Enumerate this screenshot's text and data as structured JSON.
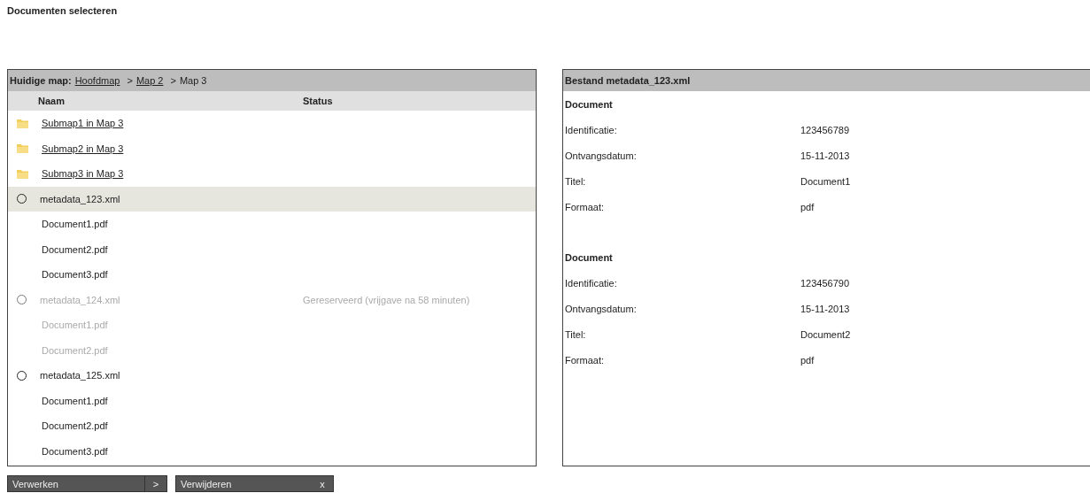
{
  "page_title": "Documenten selecteren",
  "browser": {
    "breadcrumb_label": "Huidige map:",
    "separator": ">",
    "breadcrumb": [
      {
        "label": "Hoofdmap",
        "link": true
      },
      {
        "label": "Map 2",
        "link": true
      },
      {
        "label": "Map 3",
        "link": false
      }
    ],
    "columns": [
      "Naam",
      "Status"
    ],
    "rows": [
      {
        "kind": "folder",
        "name": "Submap1 in Map 3",
        "selected": false
      },
      {
        "kind": "folder",
        "name": "Submap2 in Map 3",
        "selected": false
      },
      {
        "kind": "folder",
        "name": "Submap3 in Map 3",
        "selected": false
      },
      {
        "kind": "xml",
        "name": "metadata_123.xml",
        "selected": true,
        "disabled": false,
        "checked": false
      },
      {
        "kind": "document",
        "name": "Document1.pdf",
        "selected": false,
        "disabled": false
      },
      {
        "kind": "document",
        "name": "Document2.pdf",
        "selected": false,
        "disabled": false
      },
      {
        "kind": "document",
        "name": "Document3.pdf",
        "selected": false,
        "disabled": false
      },
      {
        "kind": "xml",
        "name": "metadata_124.xml",
        "selected": false,
        "disabled": true,
        "checked": false,
        "status": "Gereserveerd (vrijgave na 58 minuten)"
      },
      {
        "kind": "document",
        "name": "Document1.pdf",
        "selected": false,
        "disabled": true
      },
      {
        "kind": "document",
        "name": "Document2.pdf",
        "selected": false,
        "disabled": true
      },
      {
        "kind": "xml",
        "name": "metadata_125.xml",
        "selected": false,
        "disabled": false,
        "checked": false
      },
      {
        "kind": "document",
        "name": "Document1.pdf",
        "selected": false,
        "disabled": false
      },
      {
        "kind": "document",
        "name": "Document2.pdf",
        "selected": false,
        "disabled": false
      },
      {
        "kind": "document",
        "name": "Document3.pdf",
        "selected": false,
        "disabled": false
      }
    ]
  },
  "details": {
    "title": "Bestand metadata_123.xml",
    "sections": [
      {
        "heading": "Document",
        "fields": [
          {
            "label": "Identificatie:",
            "value": "123456789"
          },
          {
            "label": "Ontvangsdatum:",
            "value": "15-11-2013"
          },
          {
            "label": "Titel:",
            "value": "Document1"
          },
          {
            "label": "Formaat:",
            "value": "pdf"
          }
        ]
      },
      {
        "heading": "Document",
        "fields": [
          {
            "label": "Identificatie:",
            "value": "123456790"
          },
          {
            "label": "Ontvangsdatum:",
            "value": "15-11-2013"
          },
          {
            "label": "Titel:",
            "value": "Document2"
          },
          {
            "label": "Formaat:",
            "value": "pdf"
          }
        ]
      }
    ]
  },
  "buttons": [
    {
      "label": "Verwerken",
      "icon": ">"
    },
    {
      "label": "Verwijderen",
      "icon": "x"
    }
  ]
}
